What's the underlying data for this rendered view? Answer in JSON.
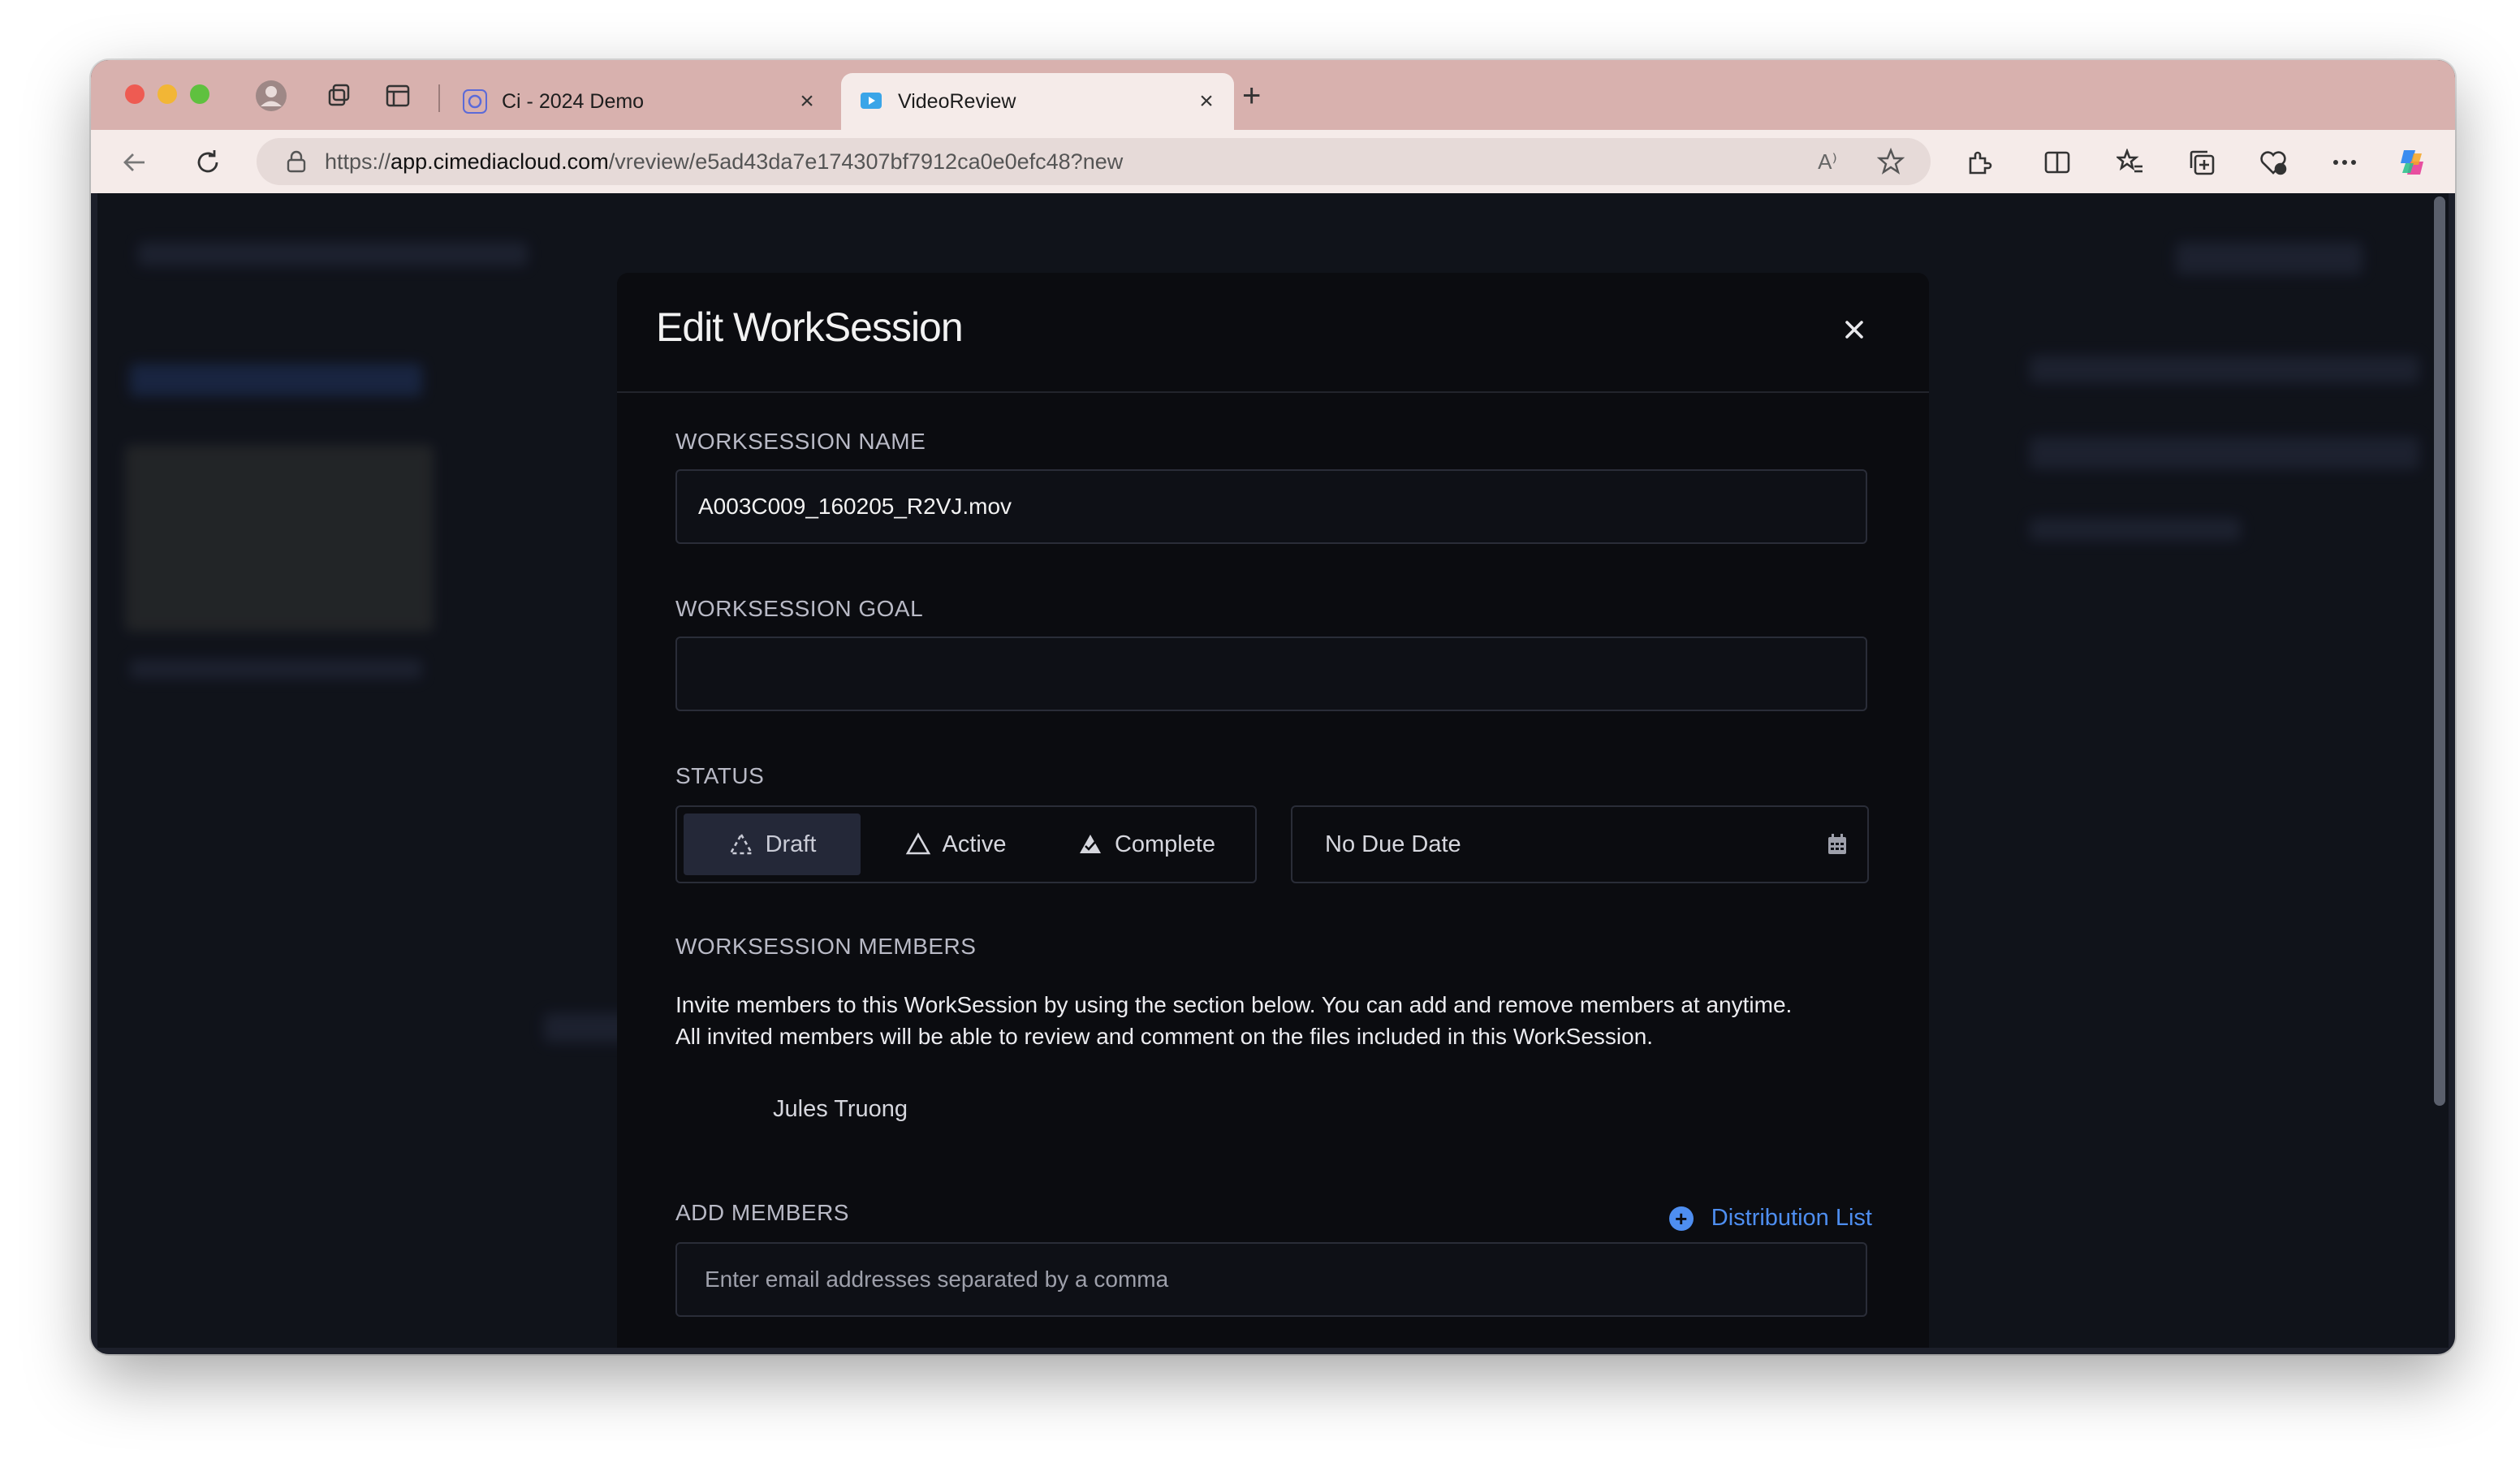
{
  "browser": {
    "tabs": [
      {
        "title": "Ci - 2024 Demo",
        "close": "×"
      },
      {
        "title": "VideoReview",
        "close": "×"
      }
    ],
    "new_tab": "+",
    "url_prefix": "https://",
    "url_host": "app.cimediacloud.com",
    "url_path": "/vreview/e5ad43da7e174307bf7912ca0e0efc48?new",
    "read_aloud": "A⁾"
  },
  "modal": {
    "title": "Edit WorkSession",
    "close": "×",
    "name_label": "WORKSESSION NAME",
    "name_value": "A003C009_160205_R2VJ.mov",
    "goal_label": "WORKSESSION GOAL",
    "goal_value": "",
    "status_label": "STATUS",
    "status_options": [
      {
        "label": "Draft",
        "selected": true
      },
      {
        "label": "Active",
        "selected": false
      },
      {
        "label": "Complete",
        "selected": false
      }
    ],
    "due_date": "No Due Date",
    "members_label": "WORKSESSION MEMBERS",
    "members_description_1": "Invite members to this WorkSession by using the section below. You can add and remove members at anytime.",
    "members_description_2": "All invited members will be able to review and comment on the files included in this WorkSession.",
    "members": [
      "Jules Truong"
    ],
    "add_members_label": "ADD MEMBERS",
    "distribution_list": "Distribution List",
    "add_members_placeholder": "Enter email addresses separated by a comma"
  },
  "colors": {
    "tabbar": "#d8b1ae",
    "modal_bg": "#0b0c10",
    "accent": "#4e8ef0"
  }
}
